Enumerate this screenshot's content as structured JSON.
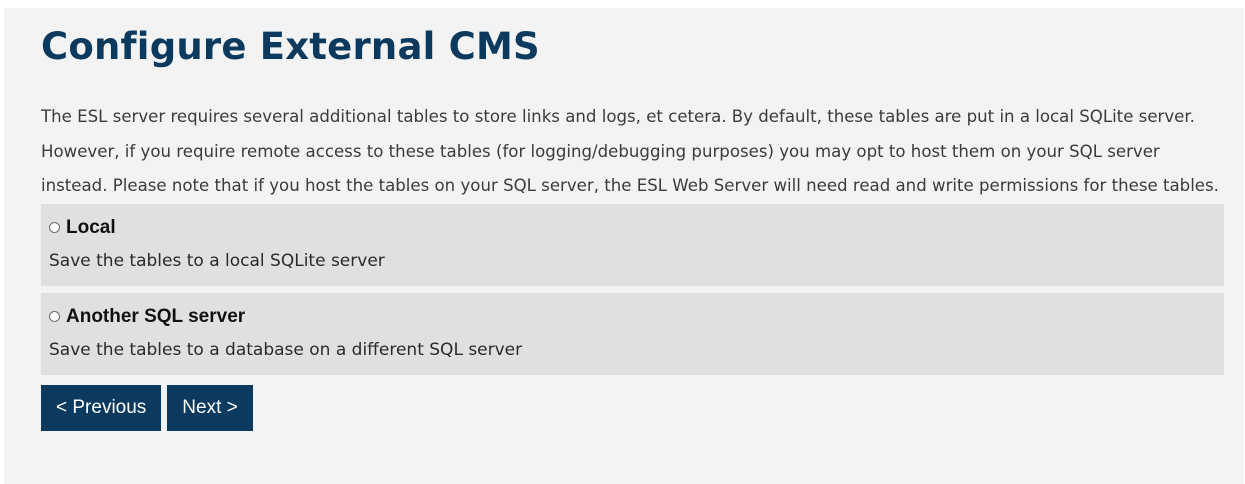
{
  "page": {
    "title": "Configure External CMS",
    "intro": "The ESL server requires several additional tables to store links and logs, et cetera. By default, these tables are put in a local SQLite server. However, if you require remote access to these tables (for logging/debugging purposes) you may opt to host them on your SQL server instead. Please note that if you host the tables on your SQL server, the ESL Web Server will need read and write permissions for these tables."
  },
  "options": [
    {
      "title": "Local",
      "description": "Save the tables to a local SQLite server",
      "selected": false
    },
    {
      "title": "Another SQL server",
      "description": "Save the tables to a database on a different SQL server",
      "selected": false
    }
  ],
  "buttons": {
    "previous_label": "< Previous",
    "next_label": "Next >"
  },
  "colors": {
    "heading": "#0b3a5e",
    "button_bg": "#0b3a5e",
    "panel_bg": "#f3f3f3",
    "option_bg": "#e0e0e0"
  }
}
